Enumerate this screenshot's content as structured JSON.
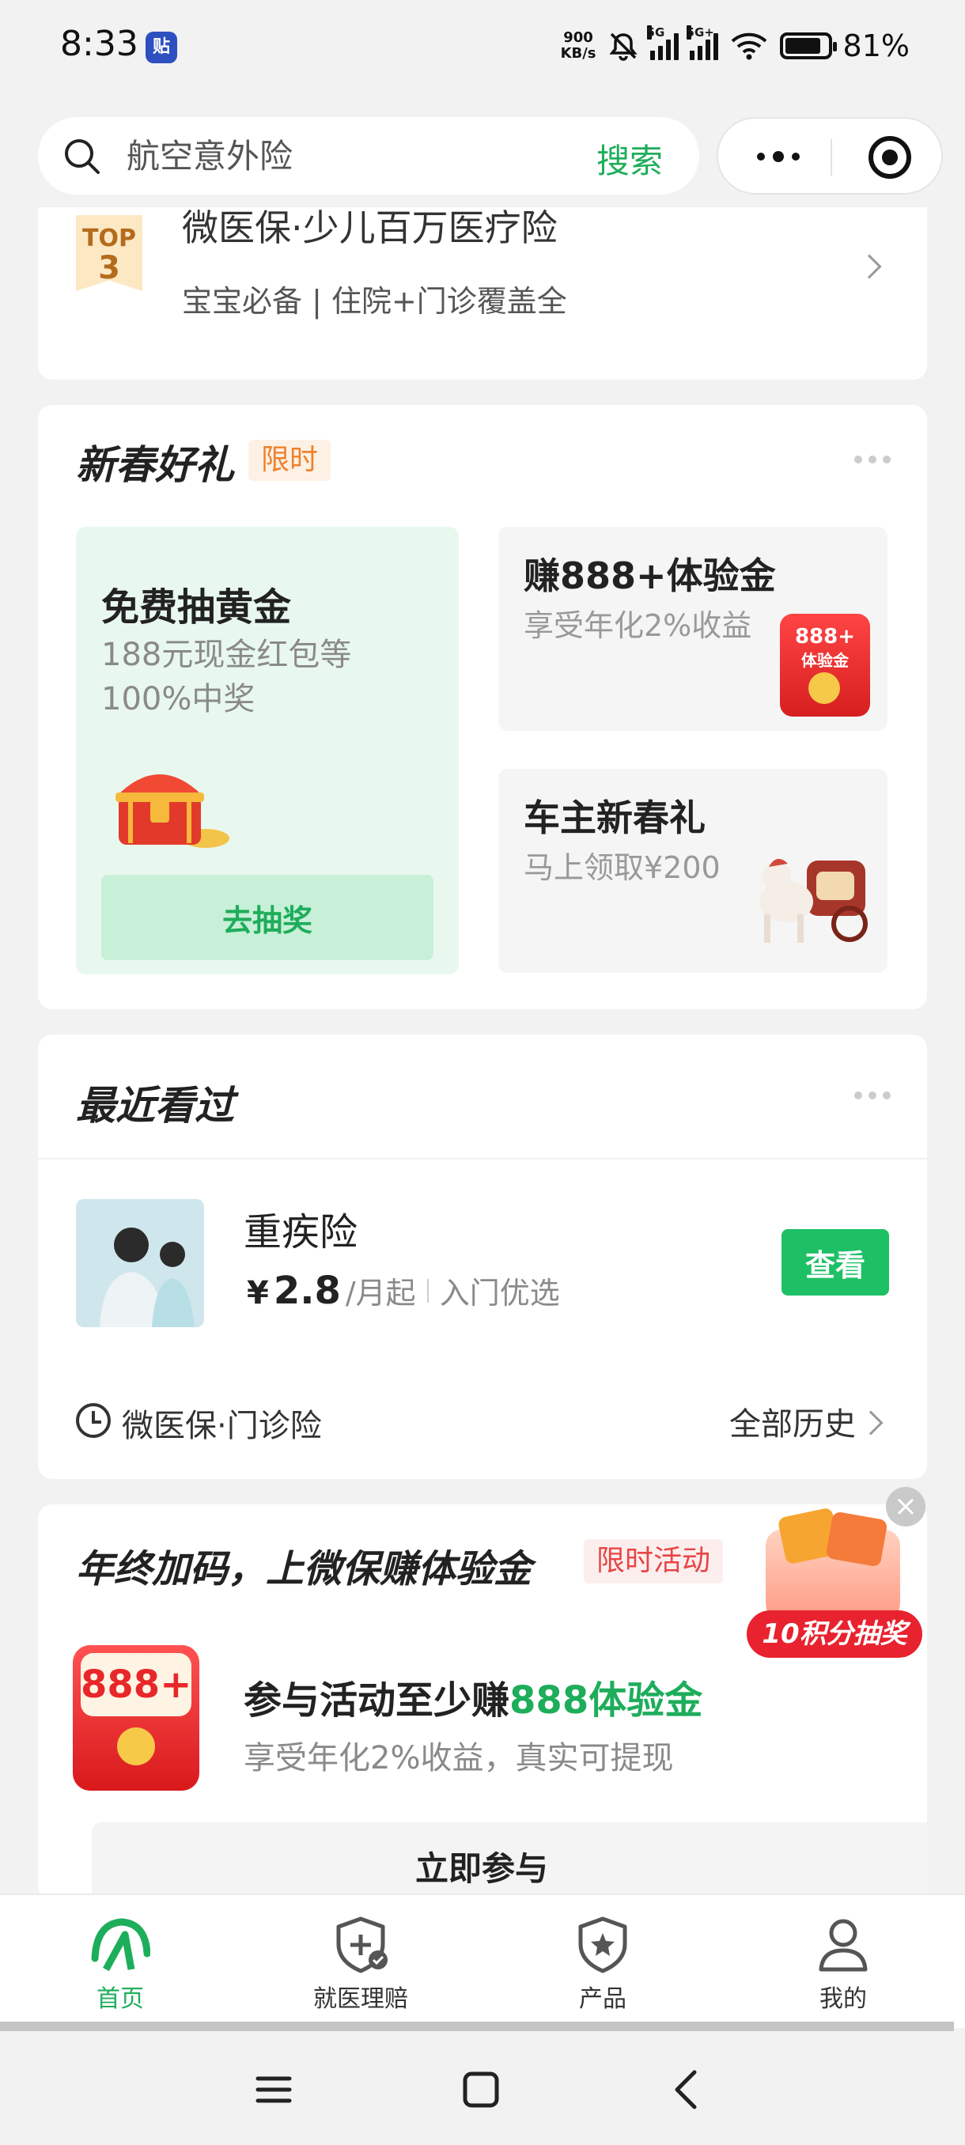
{
  "status_bar": {
    "time": "8:33",
    "app_badge": "贴",
    "net_speed_value": "900",
    "net_speed_unit": "KB/s",
    "sim1": "5G",
    "sim2": "5G+",
    "battery_percent": "81%"
  },
  "search": {
    "placeholder": "航空意外险",
    "button_label": "搜索"
  },
  "top_product": {
    "rank_label": "TOP",
    "rank_number": "3",
    "title": "微医保·少儿百万医疗险",
    "subtitle": "宝宝必备 | 住院+门诊覆盖全"
  },
  "gifts": {
    "title": "新春好礼",
    "tag": "限时",
    "big_card": {
      "title": "免费抽黄金",
      "subtitle_line1": "188元现金红包等",
      "subtitle_line2": "100%中奖",
      "button_label": "去抽奖"
    },
    "card2": {
      "title": "赚888+体验金",
      "subtitle": "享受年化2%收益",
      "icon_text1": "888+",
      "icon_text2": "体验金"
    },
    "card3": {
      "title": "车主新春礼",
      "subtitle": "马上领取¥200"
    }
  },
  "recent": {
    "title": "最近看过",
    "product": {
      "name": "重疾险",
      "price_symbol": "¥",
      "price": "2.8",
      "price_unit": "/月起",
      "tag": "入门优选",
      "button_label": "查看"
    },
    "history_label": "微医保·门诊险",
    "history_all_label": "全部历史"
  },
  "campaign": {
    "title": "年终加码，上微保赚体验金",
    "tag": "限时活动",
    "redpack_text": "888+",
    "headline_prefix": "参与活动至少赚",
    "headline_highlight": "888体验金",
    "subtitle": "享受年化2%收益，真实可提现",
    "button_label": "立即参与",
    "float_label": "10积分抽奖",
    "close_symbol": "×"
  },
  "tabs": [
    {
      "label": "首页",
      "icon": "home-icon",
      "active": true
    },
    {
      "label": "就医理赔",
      "icon": "shield-plus-icon",
      "active": false
    },
    {
      "label": "产品",
      "icon": "shield-star-icon",
      "active": false
    },
    {
      "label": "我的",
      "icon": "user-icon",
      "active": false
    }
  ],
  "colors": {
    "accent_green": "#1ead5b",
    "button_green": "#1ec066",
    "orange_tag": "#f0802a",
    "red_tag": "#e84545"
  }
}
